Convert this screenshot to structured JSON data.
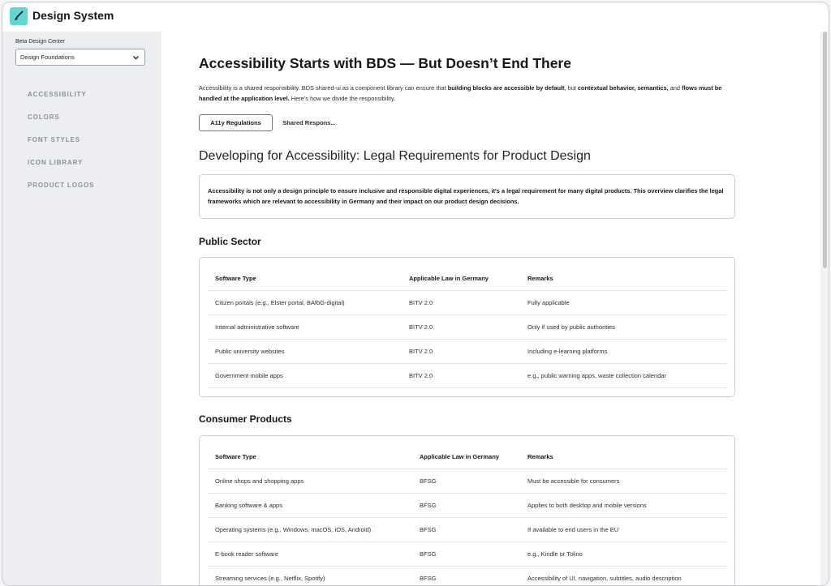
{
  "app": {
    "title": "Design System",
    "colors": {
      "accent": "#1e88e5",
      "logo": "#5fd6cf",
      "sidebar_bg": "#eceef1"
    }
  },
  "sidebar": {
    "center_label": "Beta Design Center",
    "select_value": "Design Foundations",
    "items": [
      {
        "label": "ACCESSIBILITY"
      },
      {
        "label": "COLORS"
      },
      {
        "label": "FONT STYLES"
      },
      {
        "label": "ICON LIBRARY"
      },
      {
        "label": "PRODUCT LOGOS"
      }
    ]
  },
  "main": {
    "title": "Accessibility Starts with BDS — But Doesn’t End There",
    "intro": {
      "p1": "Accessibility is a shared responsibility. BDS shared-ui as a component library can ensure that ",
      "b1": "building blocks are accessible by default",
      "p2": ", but ",
      "b2": "contextual behavior, semantics,",
      "p3": " and ",
      "b3": "flows must be handled at the application level.",
      "p4": " Here’s how we divide the responsibility."
    },
    "tabs": [
      {
        "label": "A11y Regulations",
        "active": true
      },
      {
        "label": "Shared Respons..."
      }
    ],
    "section_title": "Developing for Accessibility: Legal Requirements for Product Design",
    "callout": "Accessibility is not only a design principle to ensure inclusive and responsible digital experiences, it's a legal requirement for many digital products. This overview clarifies the legal frameworks which are relevant to accessibility in Germany and their impact on our product design decisions."
  },
  "public_sector": {
    "heading": "Public Sector",
    "columns": [
      "Software Type",
      "Applicable Law in Germany",
      "Remarks"
    ],
    "rows": [
      [
        "Citizen portals (e.g., Elster portal, BAföG-digital)",
        "BITV 2.0",
        "Fully applicable"
      ],
      [
        "Internal administrative software",
        "BITV 2.0",
        "Only if used by public authorities"
      ],
      [
        "Public university websites",
        "BITV 2.0",
        "Including e-learning platforms"
      ],
      [
        "Government mobile apps",
        "BITV 2.0",
        "e.g., public warning apps, waste collection calendar"
      ]
    ]
  },
  "consumer_products": {
    "heading": "Consumer Products",
    "columns": [
      "Software Type",
      "Applicable Law in Germany",
      "Remarks"
    ],
    "rows": [
      [
        "Online shops and shopping apps",
        "BFSG",
        "Must be accessible for consumers"
      ],
      [
        "Banking software & apps",
        "BFSG",
        "Applies to both desktop and mobile versions"
      ],
      [
        "Operating systems (e.g., Windows, macOS, iOS, Android)",
        "BFSG",
        "If available to end users in the EU"
      ],
      [
        "E-book reader software",
        "BFSG",
        "e.g., Kindle or Tolino"
      ],
      [
        "Streaming services (e.g., Netflix, Spotify)",
        "BFSG",
        "Accessibility of UI, navigation, subtitles, audio description"
      ]
    ]
  }
}
